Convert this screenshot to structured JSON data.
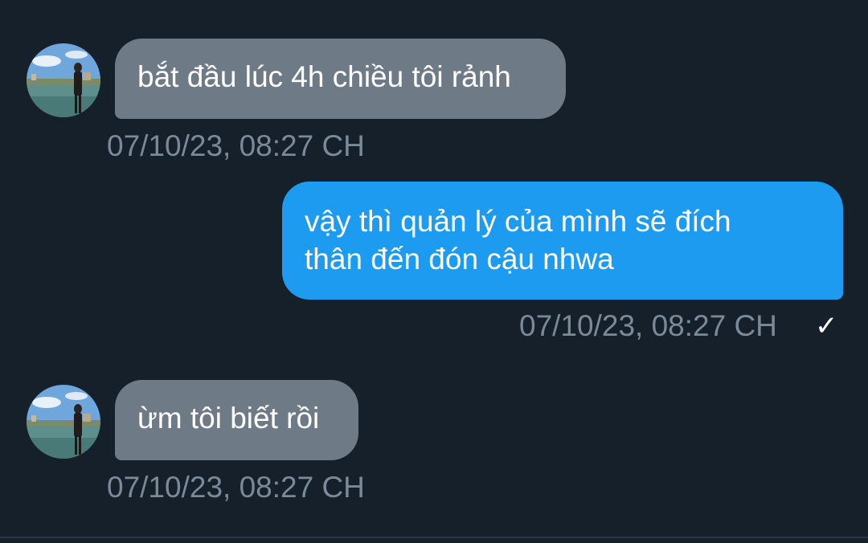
{
  "conversation": {
    "messages": [
      {
        "direction": "incoming",
        "text": "bắt đầu lúc 4h chiều tôi rảnh",
        "timestamp": "07/10/23, 08:27 CH",
        "avatar_icon": "user-avatar-photo"
      },
      {
        "direction": "outgoing",
        "lines": [
          "vậy thì quản lý của mình sẽ đích",
          "thân đến đón cậu nhwa"
        ],
        "timestamp": "07/10/23, 08:27 CH",
        "status_icon": "checkmark-icon",
        "status_glyph": "✓"
      },
      {
        "direction": "incoming",
        "text": "ừm tôi biết rồi",
        "timestamp": "07/10/23, 08:27 CH",
        "avatar_icon": "user-avatar-photo"
      }
    ]
  },
  "colors": {
    "background": "#15202b",
    "incoming_bubble": "#6e7b86",
    "outgoing_bubble": "#1d9bf0",
    "timestamp": "#7a8a99"
  }
}
